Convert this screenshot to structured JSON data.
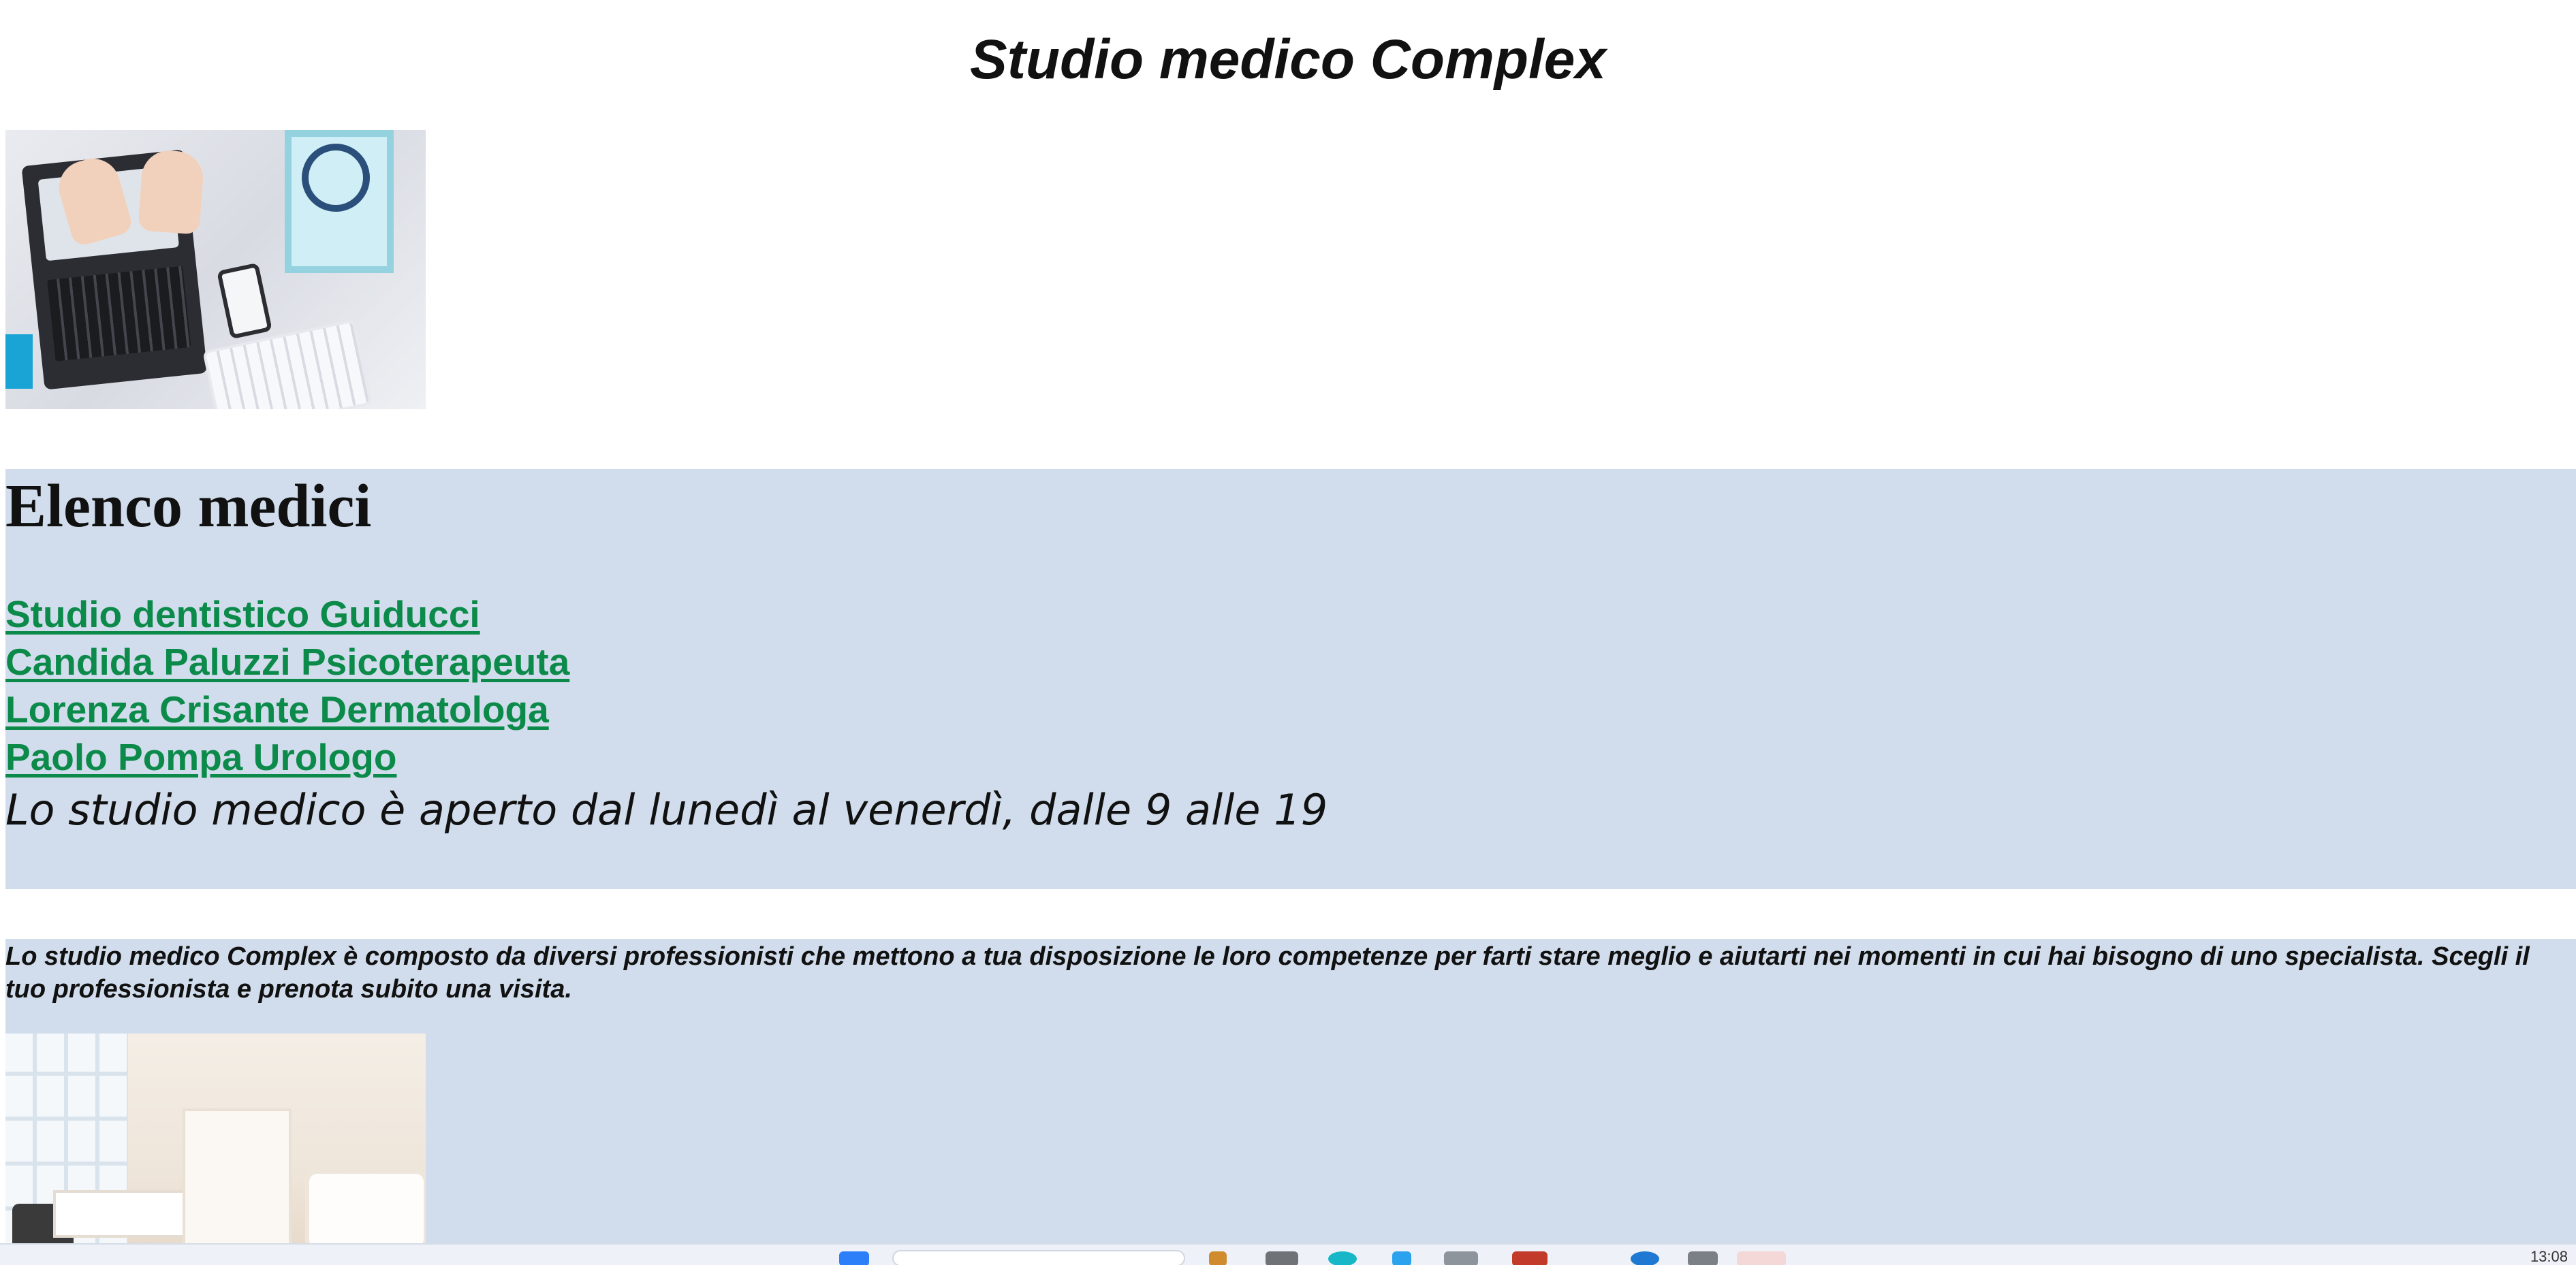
{
  "page": {
    "title": "Studio medico Complex"
  },
  "hero_image": {
    "alt": ""
  },
  "doctors_section": {
    "heading": "Elenco medici",
    "links": [
      {
        "label": "Studio dentistico Guiducci"
      },
      {
        "label": "Candida Paluzzi Psicoterapeuta"
      },
      {
        "label": "Lorenza Crisante Dermatologa"
      },
      {
        "label": "Paolo Pompa Urologo"
      }
    ],
    "hours": "Lo studio medico è aperto dal lunedì al venerdì, dalle 9 alle 19"
  },
  "about_section": {
    "text": "Lo studio medico Complex è composto da diversi professionisti che mettono a tua disposizione le loro competenze per farti stare meglio e aiutarti nei momenti in cui hai bisogno di uno specialista. Scegli il tuo professionista e prenota subito una visita."
  },
  "taskbar": {
    "clock": "13:08"
  },
  "colors": {
    "panel_background": "#d1ddec",
    "link_color": "#0b8a4a"
  }
}
